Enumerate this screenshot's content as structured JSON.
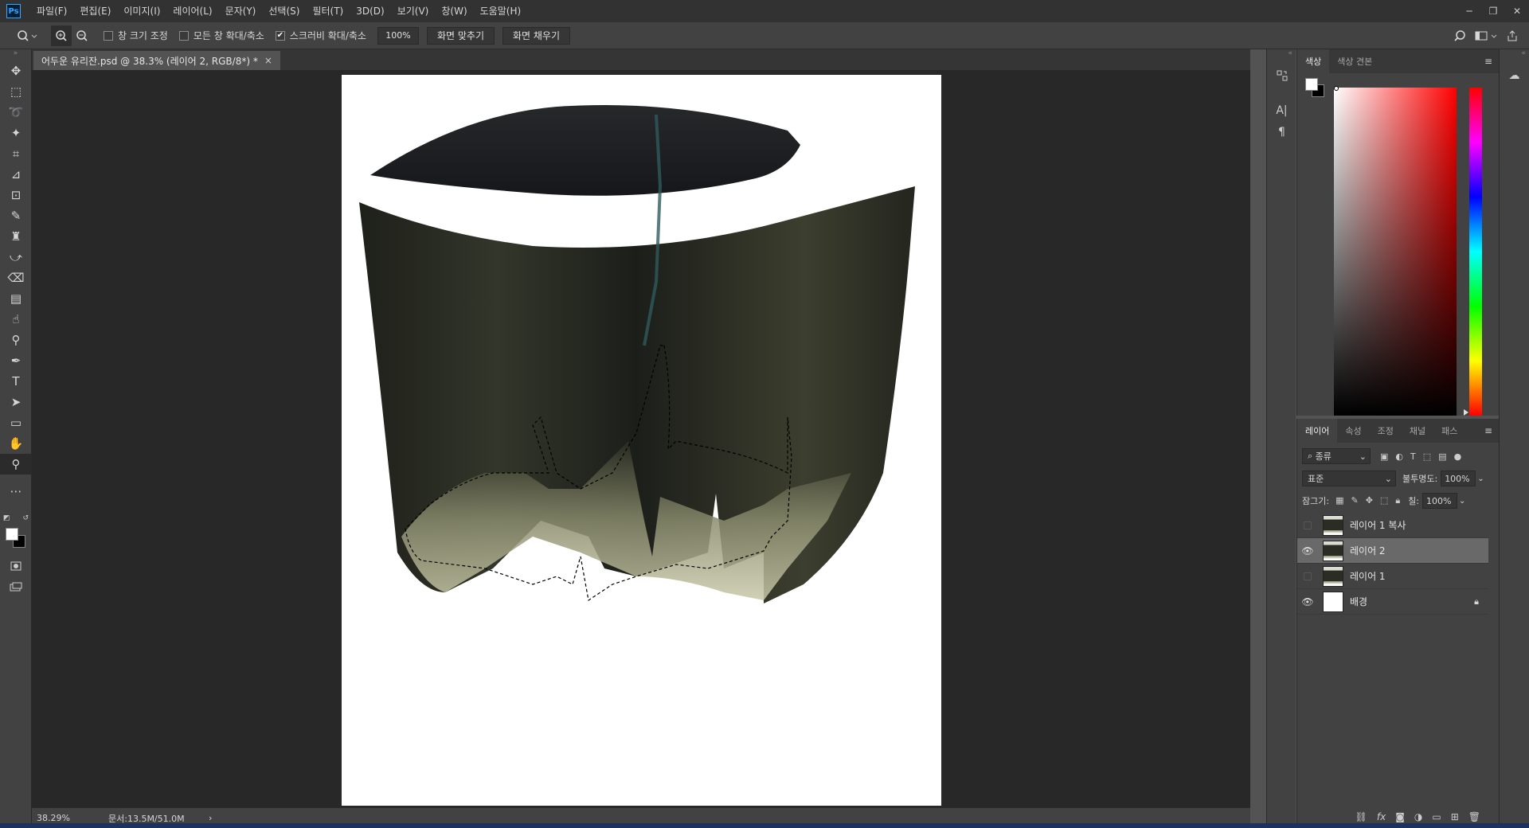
{
  "app": {
    "logo": "Ps",
    "menu": [
      "파일(F)",
      "편집(E)",
      "이미지(I)",
      "레이어(L)",
      "문자(Y)",
      "선택(S)",
      "필터(T)",
      "3D(D)",
      "보기(V)",
      "창(W)",
      "도움말(H)"
    ]
  },
  "options": {
    "resize_windows": "창 크기 조정",
    "zoom_all_windows": "모든 창 확대/축소",
    "scrubby_zoom": "스크러비 확대/축소",
    "zoom_value": "100%",
    "fit_screen": "화면 맞추기",
    "fill_screen": "화면 채우기",
    "checks": {
      "resize_windows": false,
      "zoom_all_windows": false,
      "scrubby_zoom": true
    }
  },
  "document": {
    "tab_title": "어두운 유리잔.psd @ 38.3% (레이어 2, RGB/8*) *",
    "close": "×"
  },
  "status": {
    "zoom": "38.29%",
    "doc_size": "문서:13.5M/51.0M",
    "arrow": "›"
  },
  "color_panel": {
    "tabs": [
      "색상",
      "색상 견본"
    ],
    "active_tab": 0
  },
  "layers_panel": {
    "tabs": [
      "레이어",
      "속성",
      "조정",
      "채널",
      "패스"
    ],
    "active_tab": 0,
    "filter_label": "종류",
    "blend_mode": "표준",
    "opacity_label": "불투명도:",
    "opacity_value": "100%",
    "lock_label": "잠그기:",
    "fill_label": "칠:",
    "fill_value": "100%",
    "layers": [
      {
        "name": "레이어 1 복사",
        "visible": false,
        "selected": false,
        "thumb": "glass"
      },
      {
        "name": "레이어 2",
        "visible": true,
        "selected": true,
        "thumb": "glass"
      },
      {
        "name": "레이어 1",
        "visible": false,
        "selected": false,
        "thumb": "glass"
      },
      {
        "name": "배경",
        "visible": true,
        "selected": false,
        "thumb": "white",
        "locked": true
      }
    ]
  },
  "tools": [
    "move-icon",
    "marquee-icon",
    "lasso-icon",
    "magic-wand-icon",
    "crop-icon",
    "eyedropper-icon",
    "frame-icon",
    "brush-icon",
    "stamp-icon",
    "history-brush-icon",
    "eraser-icon",
    "gradient-icon",
    "smudge-icon",
    "dodge-icon",
    "pen-icon",
    "type-icon",
    "path-select-icon",
    "rectangle-icon",
    "hand-icon",
    "zoom-icon",
    "more-icon"
  ],
  "colors": {
    "foreground": "#ffffff",
    "background": "#000000",
    "accent": "#31a8ff"
  }
}
